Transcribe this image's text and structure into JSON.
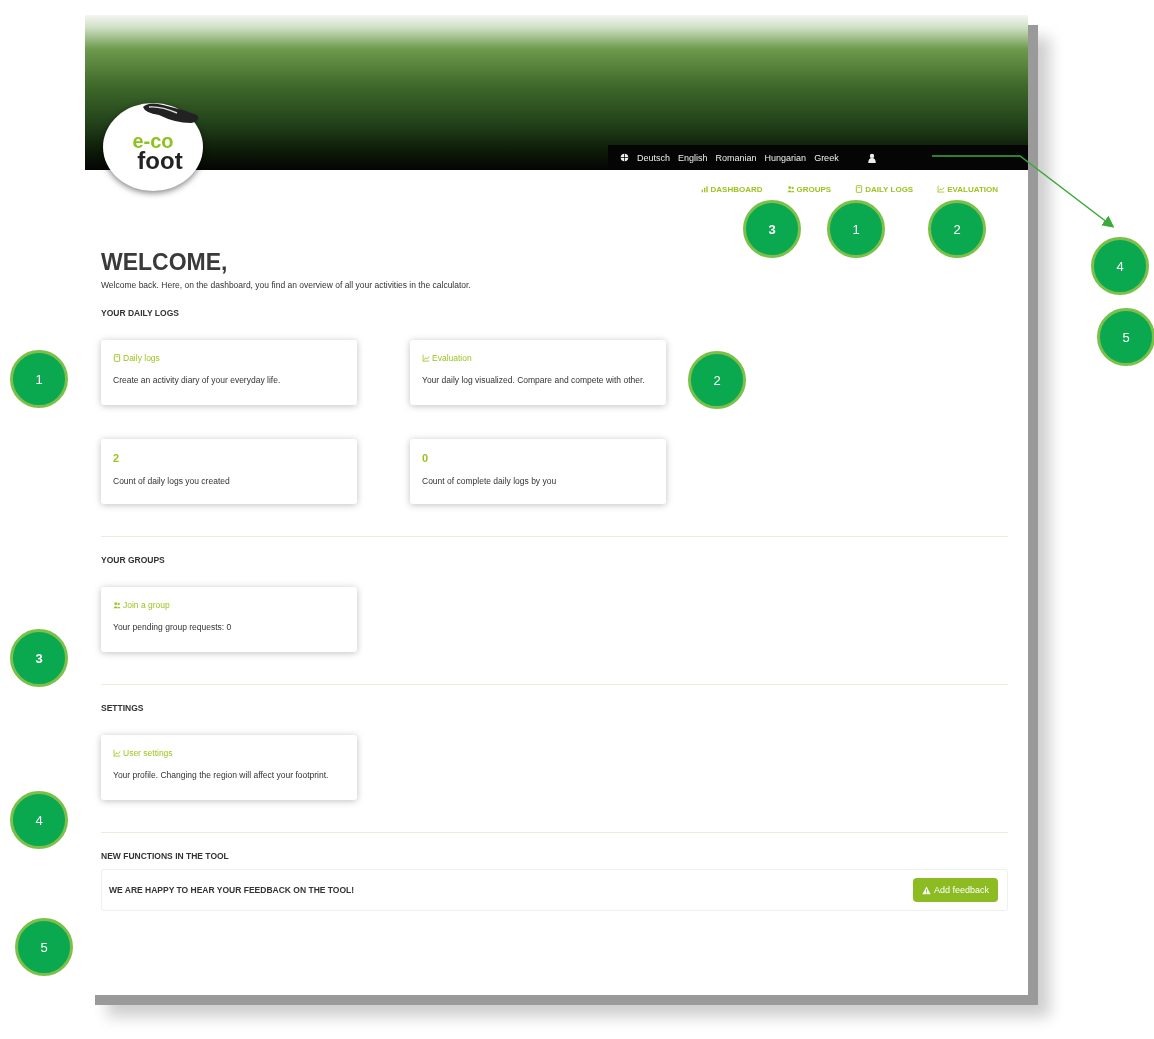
{
  "header": {
    "logo": {
      "top": "e-co",
      "bottom": "foot"
    },
    "languages": [
      "Deutsch",
      "English",
      "Romanian",
      "Hungarian",
      "Greek"
    ]
  },
  "nav": [
    {
      "label": "DASHBOARD",
      "kind": "dashboard"
    },
    {
      "label": "GROUPS",
      "kind": "groups"
    },
    {
      "label": "DAILY LOGS",
      "kind": "logs"
    },
    {
      "label": "EVALUATION",
      "kind": "chart"
    }
  ],
  "welcome": {
    "title": "WELCOME,",
    "text": "Welcome back. Here, on the dashboard, you find an overview of all your activities in the calculator."
  },
  "sections": [
    {
      "heading": "YOUR DAILY LOGS",
      "cards": [
        {
          "kind": "logs",
          "title": "Daily logs",
          "text": "Create an activity diary of your everyday life."
        },
        {
          "kind": "chart",
          "title": "Evaluation",
          "text": "Your daily log visualized. Compare and compete with other."
        },
        {
          "kind": "count",
          "title": "2",
          "text": "Count of daily logs you created"
        },
        {
          "kind": "count",
          "title": "0",
          "text": "Count of complete daily logs by you"
        }
      ]
    },
    {
      "heading": "YOUR GROUPS",
      "cards": [
        {
          "kind": "groups",
          "title": "Join a group",
          "text": "Your pending group requests: 0"
        }
      ]
    },
    {
      "heading": "SETTINGS",
      "cards": [
        {
          "kind": "chart",
          "title": "User settings",
          "text": "Your profile. Changing the region will affect your footprint."
        }
      ]
    }
  ],
  "feedback": {
    "heading": "NEW FUNCTIONS IN THE TOOL",
    "text": "WE ARE HAPPY TO HEAR YOUR FEEDBACK ON THE TOOL!",
    "button": "Add feedback"
  },
  "annotations": [
    {
      "label": "3",
      "bold": true
    },
    {
      "label": "1",
      "bold": false
    },
    {
      "label": "2",
      "bold": false
    },
    {
      "label": "4",
      "bold": false
    },
    {
      "label": "5",
      "bold": false
    },
    {
      "label": "1",
      "bold": false
    },
    {
      "label": "2",
      "bold": false
    },
    {
      "label": "3",
      "bold": true
    },
    {
      "label": "4",
      "bold": false
    },
    {
      "label": "5",
      "bold": false
    }
  ]
}
